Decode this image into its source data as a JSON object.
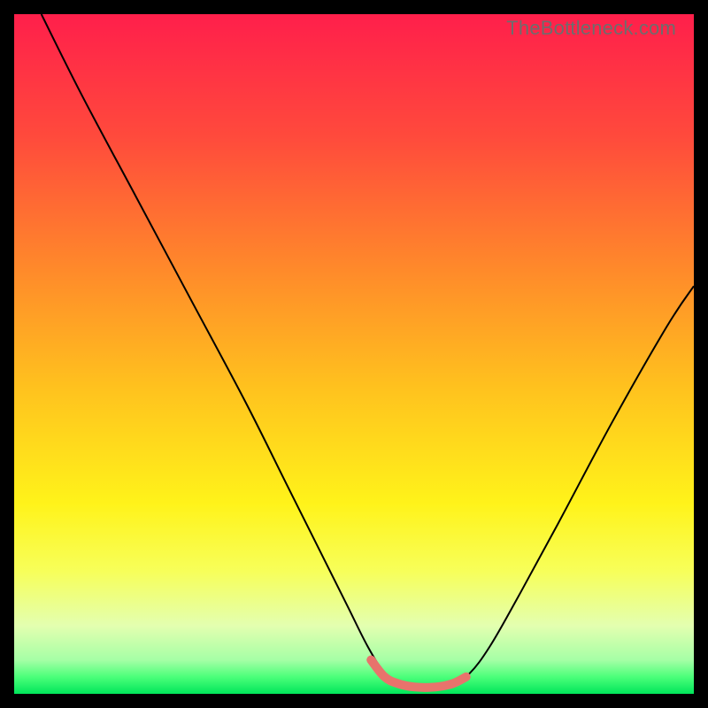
{
  "watermark": "TheBottleneck.com",
  "chart_data": {
    "type": "line",
    "title": "",
    "xlabel": "",
    "ylabel": "",
    "xlim": [
      0,
      100
    ],
    "ylim": [
      0,
      100
    ],
    "gradient_stops": [
      {
        "offset": 0.0,
        "color": "#ff1f4b"
      },
      {
        "offset": 0.18,
        "color": "#ff4a3c"
      },
      {
        "offset": 0.38,
        "color": "#ff8b2a"
      },
      {
        "offset": 0.55,
        "color": "#ffc21e"
      },
      {
        "offset": 0.72,
        "color": "#fff31a"
      },
      {
        "offset": 0.82,
        "color": "#f7ff5a"
      },
      {
        "offset": 0.9,
        "color": "#e3ffb0"
      },
      {
        "offset": 0.95,
        "color": "#a6ffa6"
      },
      {
        "offset": 0.975,
        "color": "#4cff7a"
      },
      {
        "offset": 1.0,
        "color": "#00e65a"
      }
    ],
    "series": [
      {
        "name": "bottleneck-curve",
        "color": "#000000",
        "width": 2,
        "x": [
          4,
          10,
          18,
          26,
          34,
          40,
          45,
          49,
          52,
          54.5,
          56.5,
          59,
          62,
          64.5,
          67,
          70,
          74,
          80,
          88,
          96,
          100
        ],
        "y": [
          100,
          88,
          73,
          58,
          43,
          31,
          21,
          13,
          7,
          3,
          1.5,
          1,
          1,
          1.5,
          3,
          7,
          14,
          25,
          40,
          54,
          60
        ]
      },
      {
        "name": "optimal-zone-highlight",
        "color": "#e8736c",
        "width": 10,
        "linecap": "round",
        "x": [
          52.5,
          54.5,
          56.5,
          59,
          62,
          64.5,
          66.5
        ],
        "y": [
          5,
          2.5,
          1.5,
          1,
          1,
          1.5,
          2.5
        ]
      }
    ]
  }
}
